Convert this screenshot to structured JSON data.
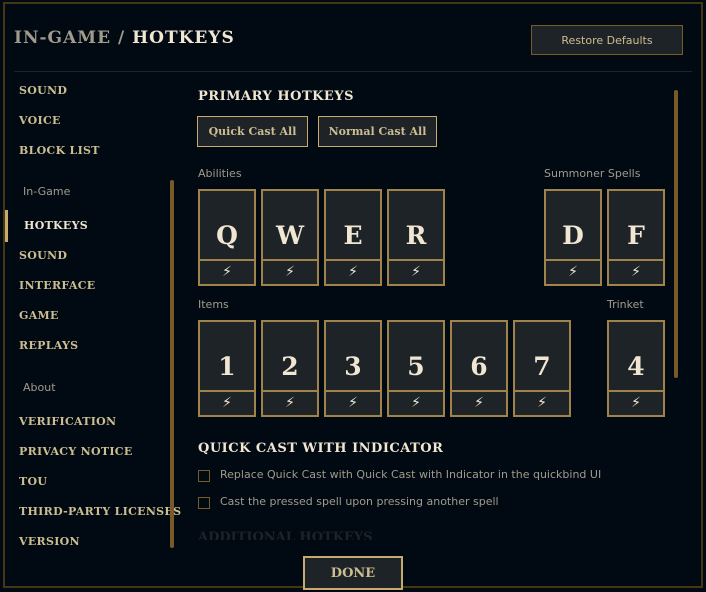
{
  "header": {
    "section": "IN-GAME",
    "separator": "/",
    "page": "HOTKEYS",
    "restore_label": "Restore Defaults"
  },
  "sidebar": {
    "top": [
      "SOUND",
      "VOICE",
      "BLOCK LIST"
    ],
    "ingame_header": "In-Game",
    "ingame": [
      "HOTKEYS",
      "SOUND",
      "INTERFACE",
      "GAME",
      "REPLAYS"
    ],
    "about_header": "About",
    "about": [
      "VERIFICATION",
      "PRIVACY NOTICE",
      "TOU",
      "THIRD-PARTY LICENSES",
      "VERSION"
    ],
    "selected": "HOTKEYS"
  },
  "main": {
    "primary_title": "PRIMARY HOTKEYS",
    "quick_cast_all": "Quick Cast All",
    "normal_cast_all": "Normal Cast All",
    "abilities_label": "Abilities",
    "abilities": [
      "Q",
      "W",
      "E",
      "R"
    ],
    "summoner_label": "Summoner Spells",
    "summoner": [
      "D",
      "F"
    ],
    "items_label": "Items",
    "items": [
      "1",
      "2",
      "3",
      "5",
      "6",
      "7"
    ],
    "trinket_label": "Trinket",
    "trinket": [
      "4"
    ],
    "quick_cast_icon": "lightning-bolt-icon",
    "indicator_title": "QUICK CAST WITH INDICATOR",
    "options": [
      {
        "label": "Replace Quick Cast with Quick Cast with Indicator in the quickbind UI",
        "checked": false
      },
      {
        "label": "Cast the pressed spell upon pressing another spell",
        "checked": false
      }
    ],
    "additional_title": "ADDITIONAL HOTKEYS"
  },
  "footer": {
    "done_label": "DONE"
  },
  "colors": {
    "background": "#010a13",
    "gold": "#c8aa6e",
    "text": "#cdbe91"
  }
}
